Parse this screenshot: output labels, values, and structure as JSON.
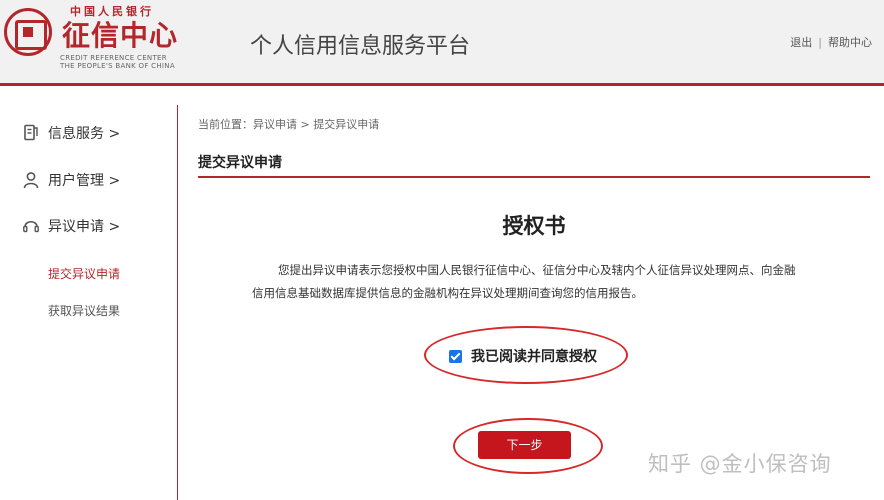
{
  "header": {
    "logo_top": "中国人民银行",
    "logo_main": "征信中心",
    "logo_en1": "CREDIT REFERENCE CENTER",
    "logo_en2": "THE PEOPLE'S BANK OF CHINA",
    "platform_title": "个人信用信息服务平台",
    "logout": "退出",
    "separator": "|",
    "help": "帮助中心"
  },
  "sidebar": {
    "items": [
      {
        "label": "信息服务 >",
        "icon": "document-icon"
      },
      {
        "label": "用户管理 >",
        "icon": "user-icon"
      },
      {
        "label": "异议申请 >",
        "icon": "headset-icon"
      }
    ],
    "sub_items": [
      {
        "label": "提交异议申请",
        "active": true
      },
      {
        "label": "获取异议结果",
        "active": false
      }
    ]
  },
  "main": {
    "breadcrumb": "当前位置：异议申请 > 提交异议申请",
    "section_title": "提交异议申请",
    "doc_title": "授权书",
    "doc_body": "您提出异议申请表示您授权中国人民银行征信中心、征信分中心及辖内个人征信异议处理网点、向金融信用信息基础数据库提供信息的金融机构在异议处理期间查询您的信用报告。",
    "agree_label": "我已阅读并同意授权",
    "agree_checked": true,
    "next_button": "下一步"
  },
  "watermark": "知乎 @金小保咨询",
  "colors": {
    "brand": "#b3272c",
    "button": "#c4161c",
    "checkbox": "#1a73e8",
    "annotation": "#d42a2a"
  }
}
